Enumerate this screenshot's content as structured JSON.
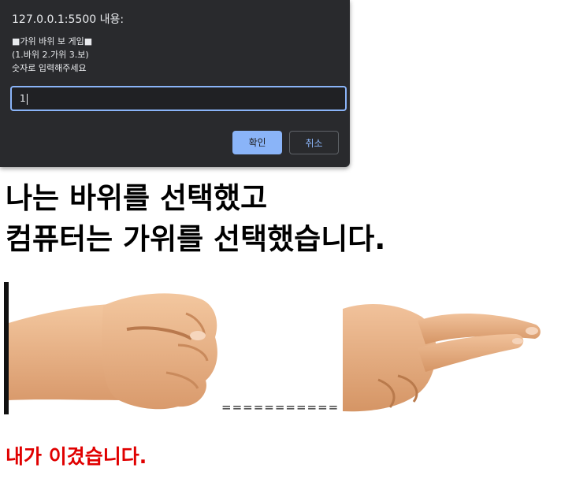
{
  "dialog": {
    "title": "127.0.0.1:5500 내용:",
    "message_line1": "■가위 바위 보 게임■",
    "message_line2": "(1.바위 2.가위 3.보)",
    "message_line3": "숫자로 입력해주세요",
    "input_value": "1",
    "ok_label": "확인",
    "cancel_label": "취소"
  },
  "page": {
    "line1": "나는 바위를 선택했고",
    "line2": "컴퓨터는 가위를 선택했습니다.",
    "separator": "===========",
    "result": "내가 이겼습니다.",
    "result_color": "#e00000"
  },
  "images": {
    "left_hand": "rock-hand",
    "right_hand": "scissors-hand"
  }
}
